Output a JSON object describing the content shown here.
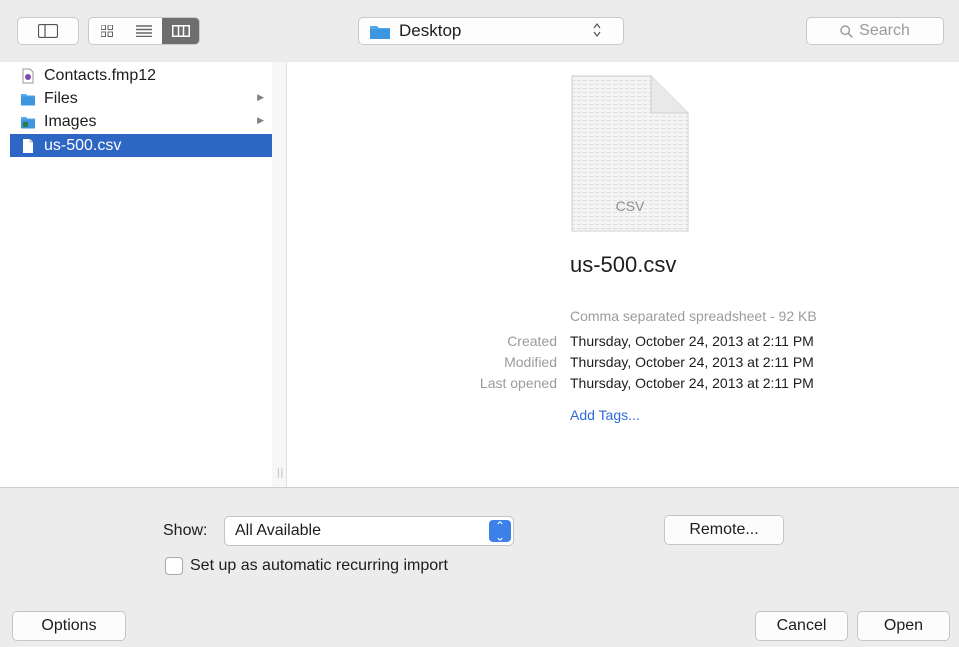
{
  "toolbar": {
    "location": "Desktop",
    "search_placeholder": "Search"
  },
  "sidebar": {
    "items": [
      {
        "label": "Contacts.fmp12",
        "icon": "filemaker-doc-icon"
      },
      {
        "label": "Files",
        "icon": "folder-icon"
      },
      {
        "label": "Images",
        "icon": "image-folder-icon"
      },
      {
        "label": "us-500.csv",
        "icon": "csv-file-icon",
        "selected": true
      }
    ]
  },
  "preview": {
    "icon_label": "CSV",
    "filename": "us-500.csv",
    "kind": "Comma separated spreadsheet - 92 KB",
    "created_label": "Created",
    "created": "Thursday, October 24, 2013 at 2:11 PM",
    "modified_label": "Modified",
    "modified": "Thursday, October 24, 2013 at 2:11 PM",
    "opened_label": "Last opened",
    "opened": "Thursday, October 24, 2013 at 2:11 PM",
    "tags": "Add Tags..."
  },
  "options": {
    "show_label": "Show:",
    "show_value": "All Available",
    "remote_label": "Remote...",
    "recurring_label": "Set up as automatic recurring import",
    "recurring_checked": false
  },
  "buttons": {
    "options": "Options",
    "cancel": "Cancel",
    "open": "Open"
  },
  "colors": {
    "selection": "#2e66c4",
    "link": "#2e6bd6",
    "popup_accent": "#3c80e8"
  }
}
